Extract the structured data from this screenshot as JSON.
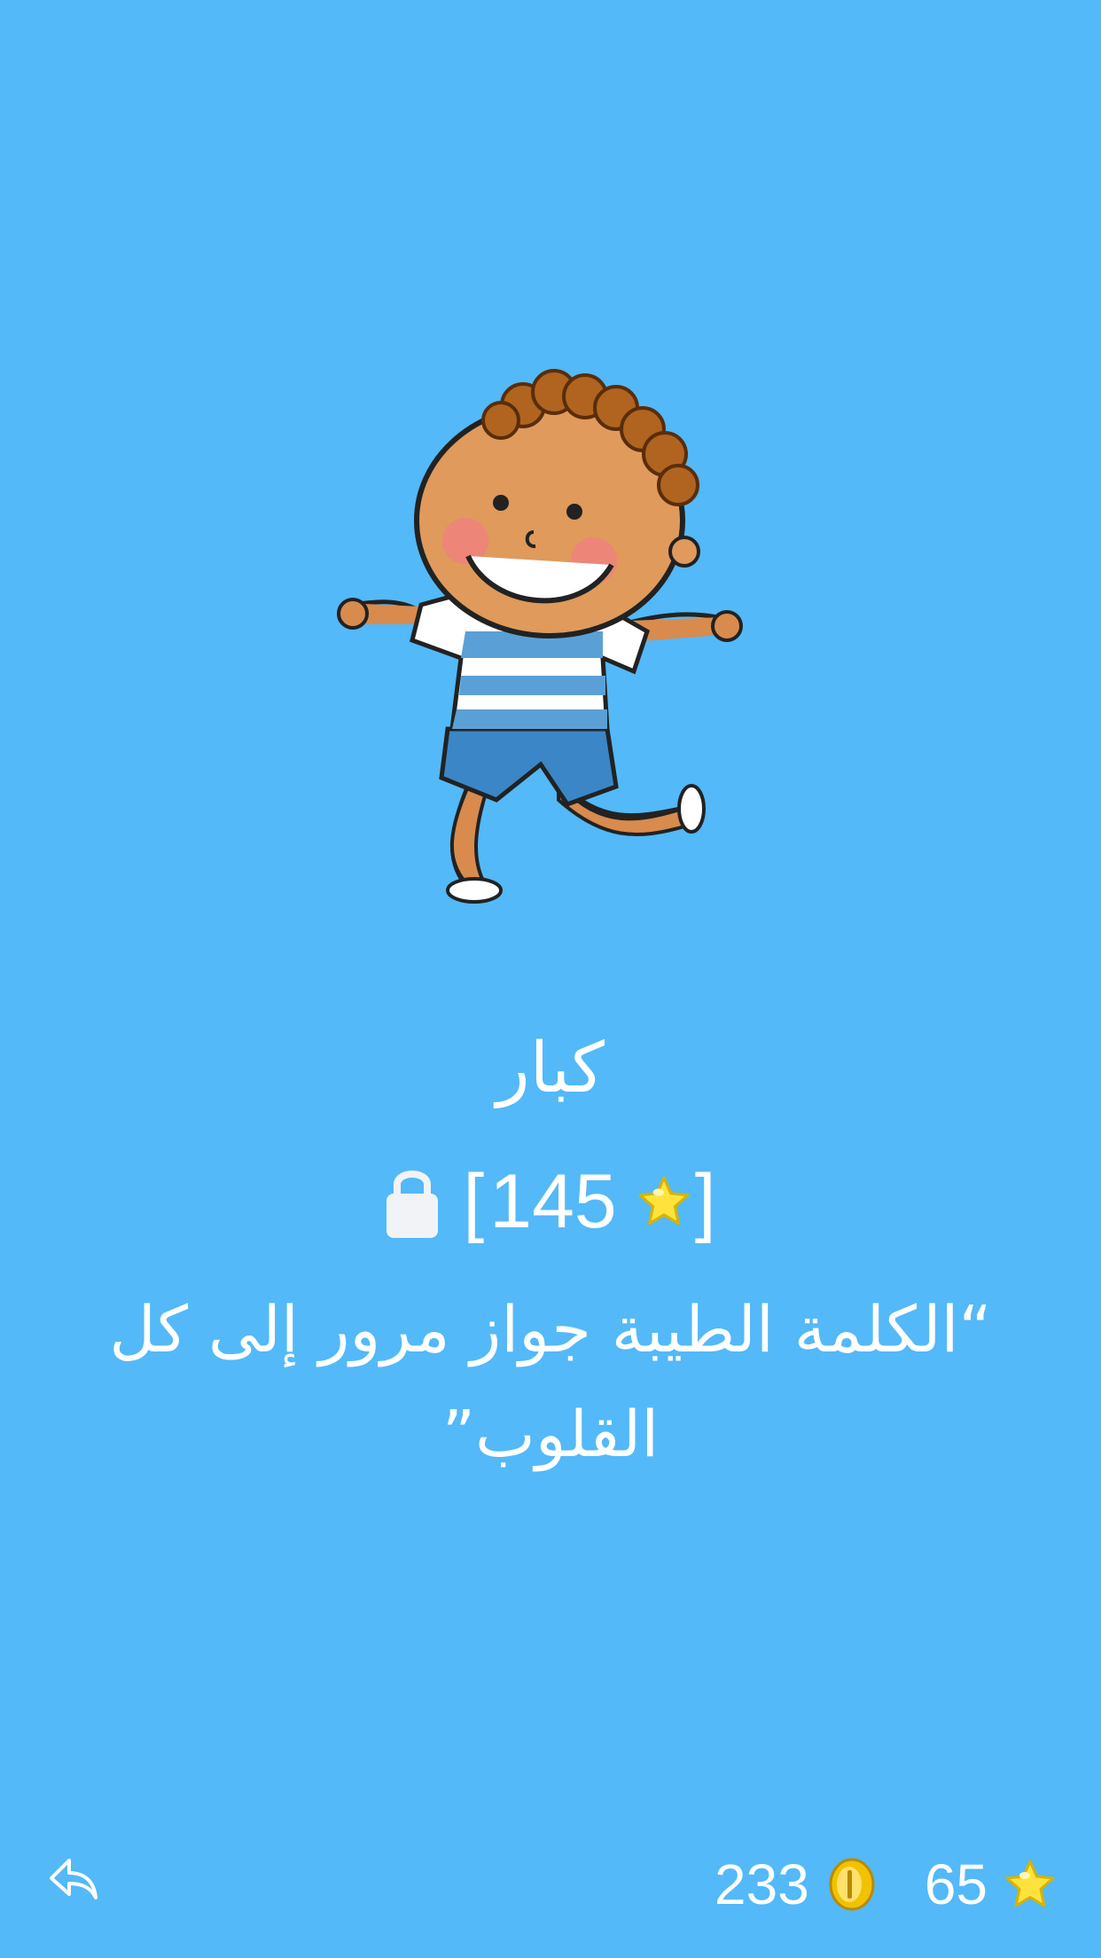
{
  "level": {
    "name": "كبار",
    "required_stars": "145",
    "locked": true,
    "quote": "“الكلمة الطيبة جواز مرور إلى كل القلوب”"
  },
  "stats": {
    "coins": "233",
    "stars": "65"
  },
  "icons": {
    "back": "reply-arrow-icon",
    "lock": "lock-icon",
    "coin": "coin-icon",
    "star": "star-icon"
  },
  "colors": {
    "background": "#53b9f8",
    "text": "#ffffff",
    "star": "#ffe23b",
    "coin": "#f2c200"
  }
}
